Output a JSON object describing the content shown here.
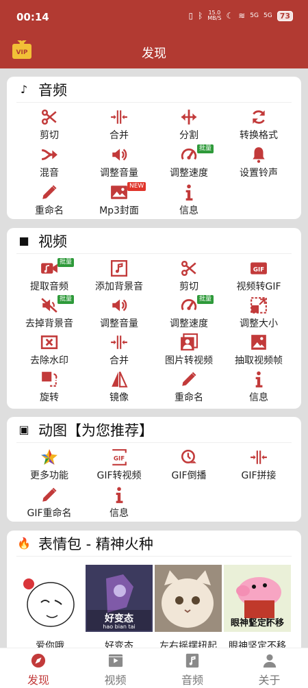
{
  "status": {
    "time": "00:14",
    "speed": "15.0",
    "speed_unit": "MB/S",
    "net1": "5G",
    "net2": "5G",
    "battery": "73"
  },
  "appbar": {
    "title": "发现",
    "vip_label": "VIP"
  },
  "audio": {
    "title": "音频",
    "tools": [
      {
        "label": "剪切",
        "icon": "scissors-icon"
      },
      {
        "label": "合并",
        "icon": "merge-icon"
      },
      {
        "label": "分割",
        "icon": "split-icon"
      },
      {
        "label": "转换格式",
        "icon": "convert-icon"
      },
      {
        "label": "混音",
        "icon": "mix-icon"
      },
      {
        "label": "调整音量",
        "icon": "volume-icon"
      },
      {
        "label": "调整速度",
        "icon": "speed-icon",
        "badge": "批量"
      },
      {
        "label": "设置铃声",
        "icon": "bell-icon"
      },
      {
        "label": "重命名",
        "icon": "pencil-icon"
      },
      {
        "label": "Mp3封面",
        "icon": "cover-icon",
        "badge": "NEW"
      },
      {
        "label": "信息",
        "icon": "info-icon"
      }
    ]
  },
  "video": {
    "title": "视频",
    "tools": [
      {
        "label": "提取音频",
        "icon": "extract-audio-icon",
        "badge": "批量"
      },
      {
        "label": "添加背景音",
        "icon": "music-icon"
      },
      {
        "label": "剪切",
        "icon": "scissors-icon"
      },
      {
        "label": "视频转GIF",
        "icon": "gif-icon",
        "icon_text": "GIF"
      },
      {
        "label": "去掉背景音",
        "icon": "mute-icon",
        "badge": "批量"
      },
      {
        "label": "调整音量",
        "icon": "volume-icon"
      },
      {
        "label": "调整速度",
        "icon": "speed-icon",
        "badge": "批量"
      },
      {
        "label": "调整大小",
        "icon": "resize-icon"
      },
      {
        "label": "去除水印",
        "icon": "watermark-icon"
      },
      {
        "label": "合并",
        "icon": "merge-icon"
      },
      {
        "label": "图片转视频",
        "icon": "images-icon"
      },
      {
        "label": "抽取视频帧",
        "icon": "frame-icon"
      },
      {
        "label": "旋转",
        "icon": "rotate-icon"
      },
      {
        "label": "镜像",
        "icon": "mirror-icon"
      },
      {
        "label": "重命名",
        "icon": "pencil-icon"
      },
      {
        "label": "信息",
        "icon": "info-icon"
      }
    ]
  },
  "gif": {
    "title": "动图【为您推荐】",
    "tools": [
      {
        "label": "更多功能",
        "icon": "star-icon"
      },
      {
        "label": "GIF转视频",
        "icon": "gif-video-icon",
        "icon_text": "GIF"
      },
      {
        "label": "GIF倒播",
        "icon": "reverse-icon"
      },
      {
        "label": "GIF拼接",
        "icon": "merge-icon"
      },
      {
        "label": "GIF重命名",
        "icon": "pencil-icon"
      },
      {
        "label": "信息",
        "icon": "info-icon"
      }
    ]
  },
  "memes": {
    "title": "表情包 - 精神火种",
    "items": [
      {
        "caption": "爱你哦"
      },
      {
        "caption": "好变态",
        "overlay": "好变态",
        "overlay_pinyin": "hao bian tai"
      },
      {
        "caption": "左右摇摆扭起"
      },
      {
        "caption": "眼神坚定不移",
        "overlay": "眼神坚定不移"
      }
    ]
  },
  "bottom_nav": [
    {
      "label": "发现",
      "icon": "compass-icon",
      "active": true
    },
    {
      "label": "视频",
      "icon": "video-icon",
      "active": false
    },
    {
      "label": "音频",
      "icon": "audio-icon",
      "active": false
    },
    {
      "label": "关于",
      "icon": "person-icon",
      "active": false
    }
  ],
  "colors": {
    "brand": "#b23a32",
    "icon": "#c23a3a",
    "badge_green": "#2e9a3a",
    "badge_red": "#e0352b"
  }
}
